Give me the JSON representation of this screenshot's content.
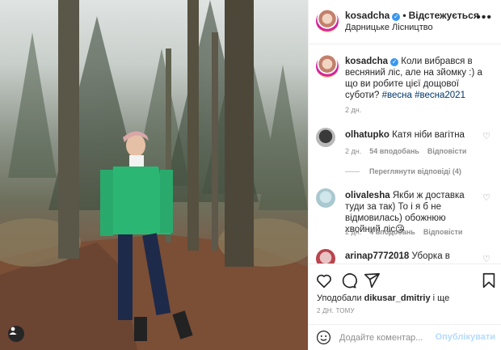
{
  "post": {
    "author": "kosadcha",
    "follow_status": "Відстежується",
    "location": "Дарницьке Лісництво",
    "caption_text": "Коли вибрався в весняний ліс, але на зйомку :) а що ви робите цієї дощової суботи?",
    "hashtags": "#весна #весна2021",
    "caption_time": "2 дн."
  },
  "comments": [
    {
      "user": "olhatupko",
      "text": "Катя ніби вагітна",
      "time": "2 дн.",
      "likes": "54 вподобань",
      "reply": "Відповісти",
      "view_replies": "Переглянути відповіді (4)"
    },
    {
      "user": "olivalesha",
      "text": "Якби ж доставка туди за так) То і я б не відмовилась) обожнюю хвойний ліс😘",
      "time": "2 дн.",
      "likes": "4 вподобань",
      "reply": "Відповісти"
    },
    {
      "user": "arinap7772018",
      "text": "Уборка в"
    }
  ],
  "actions": {
    "liked_by_prefix": "Уподобали",
    "liked_by_user": "dikusar_dmitriy",
    "liked_by_suffix": "і ще",
    "date": "2 ДН. ТОМУ"
  },
  "add_comment": {
    "placeholder": "Додайте коментар...",
    "publish_label": "Опублікувати"
  },
  "colors": {
    "accent_blue": "#3897f0",
    "publish_disabled": "#b3dbff",
    "muted_text": "#8e8e8e",
    "border": "#efefef"
  },
  "icons": [
    "more-icon",
    "verified-icon",
    "heart-icon",
    "comment-icon",
    "share-icon",
    "bookmark-icon",
    "emoji-icon",
    "user-tag-icon"
  ]
}
